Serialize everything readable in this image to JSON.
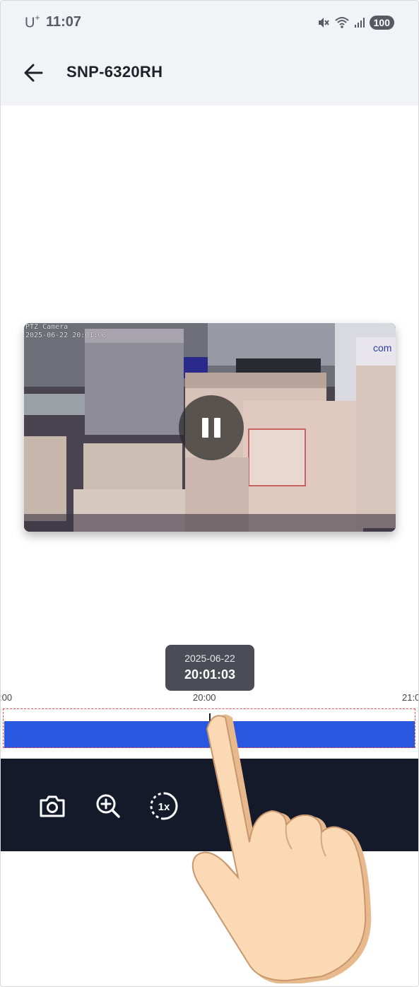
{
  "status_bar": {
    "carrier": "U",
    "carrier_sup": "+",
    "time": "11:07",
    "battery": "100",
    "icons": [
      "mute-icon",
      "wifi-icon",
      "signal-icon"
    ]
  },
  "app_bar": {
    "title": "SNP-6320RH",
    "back_icon": "arrow-left-icon"
  },
  "video": {
    "osd_line1": "PTZ Camera",
    "osd_line2": "2025-06-22 20:01:06",
    "state": "playing",
    "control_icon": "pause-icon"
  },
  "timeline": {
    "tooltip_date": "2025-06-22",
    "tooltip_time": "20:01:03",
    "tick_left": ":00",
    "tick_center": "20:00",
    "tick_right": "21:0",
    "bar_color": "#2a57e0",
    "highlight_color": "#e05050"
  },
  "toolbar": {
    "buttons": [
      {
        "name": "snapshot",
        "icon": "camera-icon"
      },
      {
        "name": "zoom-in",
        "icon": "zoom-in-icon"
      },
      {
        "name": "speed",
        "icon": "speed-1x-icon",
        "label": "1x"
      }
    ]
  },
  "overlay": {
    "gesture": "tap-hand"
  }
}
